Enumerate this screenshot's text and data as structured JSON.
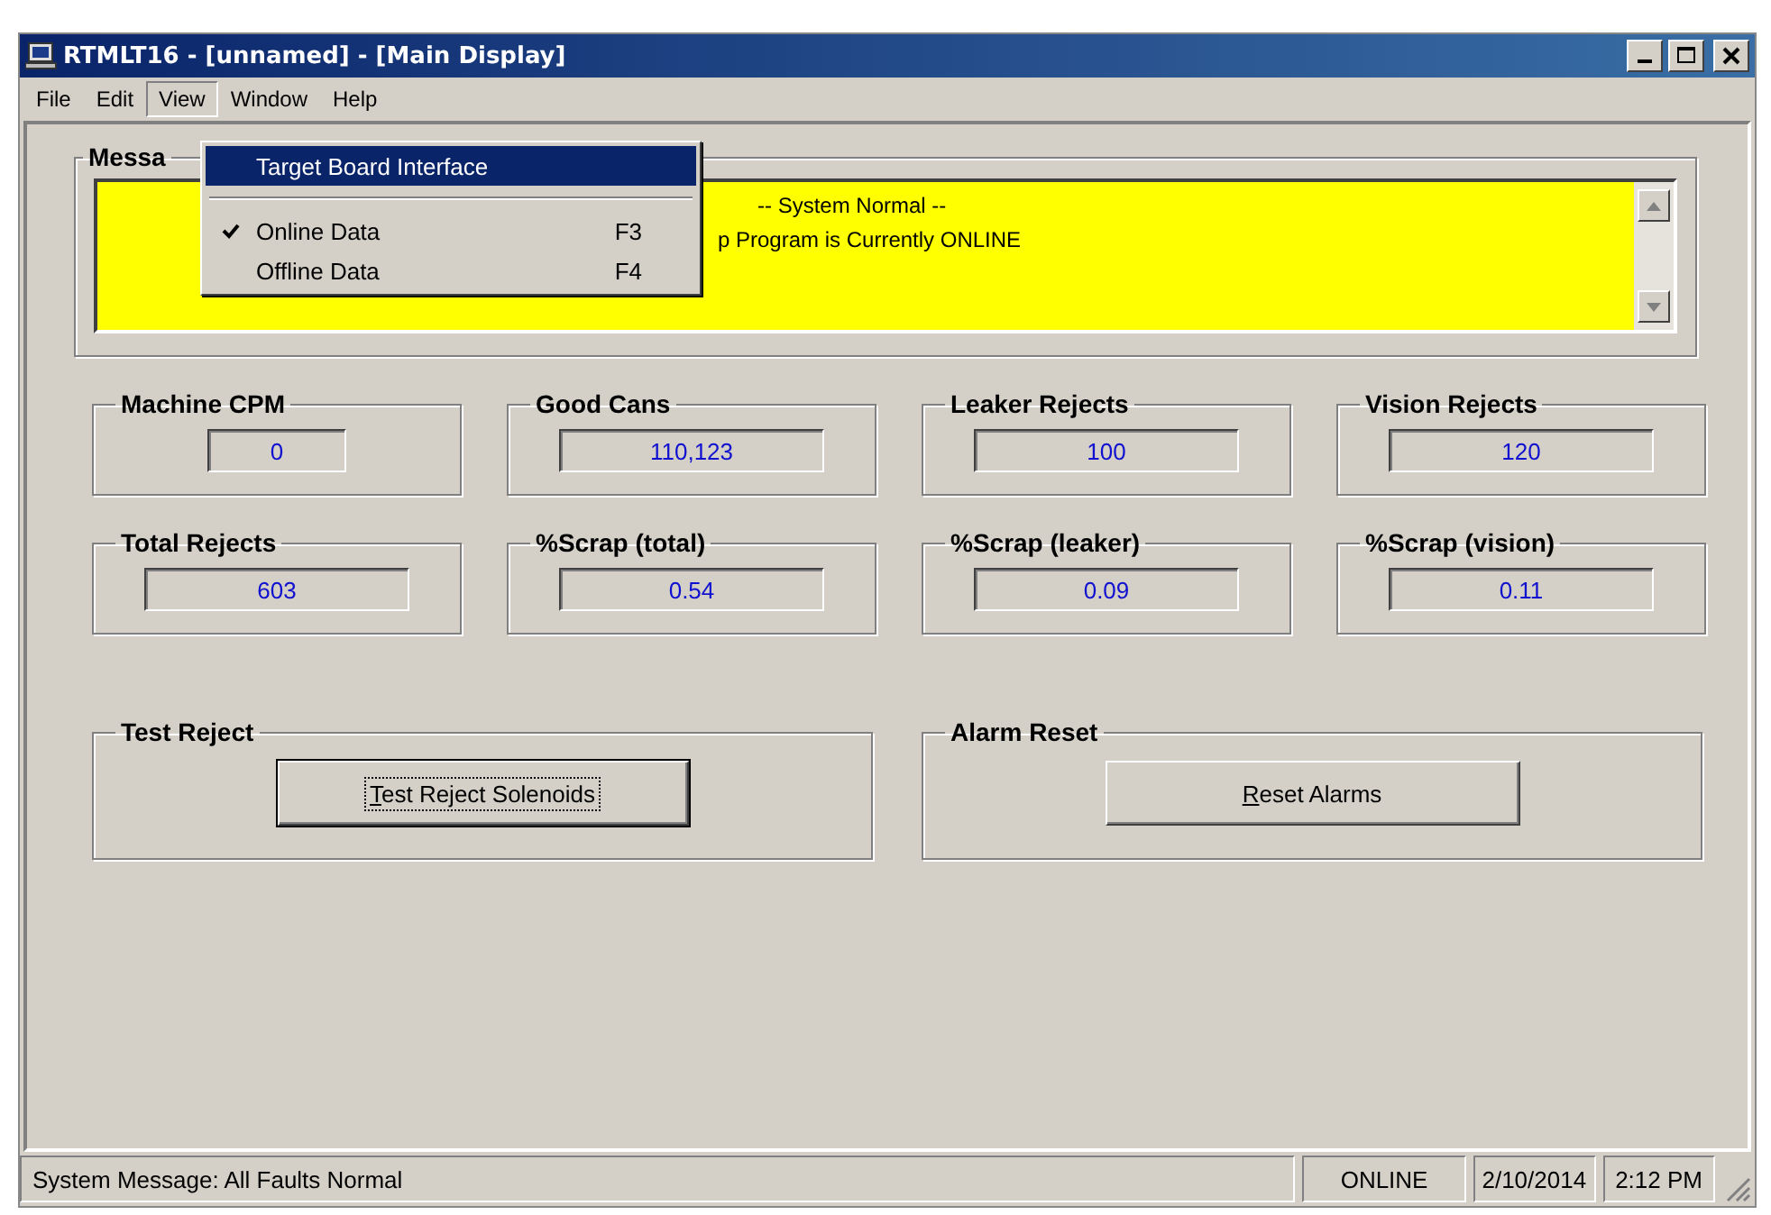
{
  "window": {
    "title": "RTMLT16 - [unnamed] - [Main Display]"
  },
  "menu_bar": [
    {
      "label": "File",
      "selected": false
    },
    {
      "label": "Edit",
      "selected": false
    },
    {
      "label": "View",
      "selected": true
    },
    {
      "label": "Window",
      "selected": false
    },
    {
      "label": "Help",
      "selected": false
    }
  ],
  "view_menu": {
    "items": [
      {
        "kind": "item",
        "label": "Target Board Interface",
        "checked": false,
        "selected": true
      },
      {
        "kind": "separator"
      },
      {
        "kind": "item",
        "label": "Online Data",
        "shortcut": "F3",
        "checked": true,
        "selected": false
      },
      {
        "kind": "item",
        "label": "Offline Data",
        "shortcut": "F4",
        "checked": false,
        "selected": false
      }
    ]
  },
  "message_group": {
    "legend": "Messa",
    "lines": [
      "-- System Normal --",
      "p Program is Currently ONLINE"
    ]
  },
  "stats": [
    [
      {
        "label": "Machine CPM",
        "value": "0"
      },
      {
        "label": "Good Cans",
        "value": "110,123"
      },
      {
        "label": "Leaker Rejects",
        "value": "100"
      },
      {
        "label": "Vision Rejects",
        "value": "120"
      }
    ],
    [
      {
        "label": "Total Rejects",
        "value": "603"
      },
      {
        "label": "%Scrap (total)",
        "value": "0.54"
      },
      {
        "label": "%Scrap (leaker)",
        "value": "0.09"
      },
      {
        "label": "%Scrap (vision)",
        "value": "0.11"
      }
    ]
  ],
  "actions": [
    {
      "legend": "Test Reject",
      "button": {
        "mnemonic": "T",
        "rest": "est Reject Solenoids",
        "focused": true
      }
    },
    {
      "legend": "Alarm Reset",
      "button": {
        "mnemonic": "R",
        "rest": "eset Alarms",
        "focused": false
      }
    }
  ],
  "status_bar": {
    "message": "System Message:  All Faults Normal",
    "mode": "ONLINE",
    "date": "2/10/2014",
    "time": "2:12 PM"
  }
}
